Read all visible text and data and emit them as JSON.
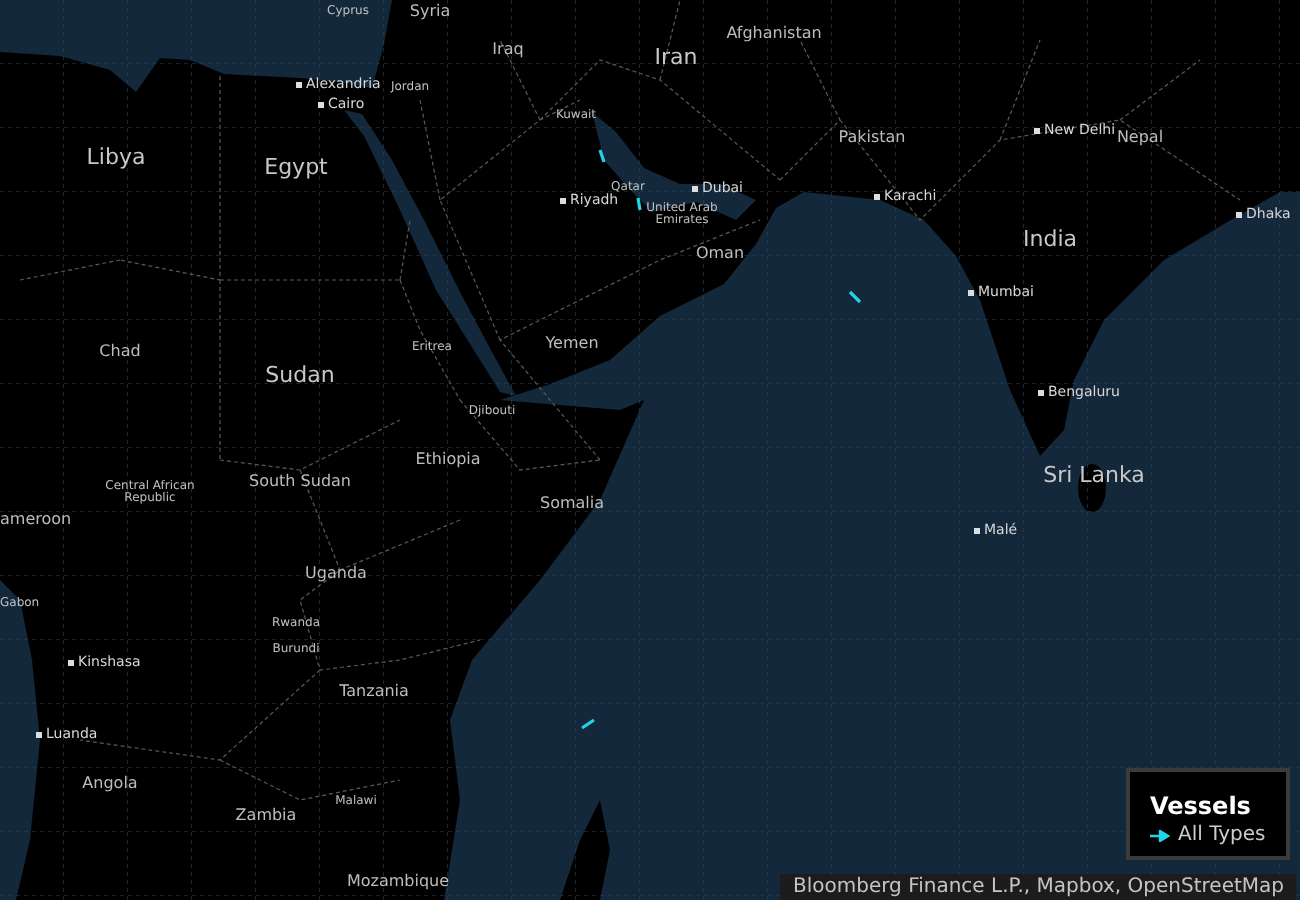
{
  "map": {
    "labels": [
      {
        "text": "Cyprus",
        "kind": "small"
      },
      {
        "text": "Syria",
        "kind": "country"
      },
      {
        "text": "Iraq",
        "kind": "country"
      },
      {
        "text": "Iran",
        "kind": "major"
      },
      {
        "text": "Afghanistan",
        "kind": "country"
      },
      {
        "text": "Alexandria",
        "kind": "city"
      },
      {
        "text": "Cairo",
        "kind": "city"
      },
      {
        "text": "Jordan",
        "kind": "small"
      },
      {
        "text": "Kuwait",
        "kind": "small"
      },
      {
        "text": "Libya",
        "kind": "major"
      },
      {
        "text": "Egypt",
        "kind": "major"
      },
      {
        "text": "Pakistan",
        "kind": "country"
      },
      {
        "text": "New Delhi",
        "kind": "city"
      },
      {
        "text": "Nepal",
        "kind": "country"
      },
      {
        "text": "Qatar",
        "kind": "small"
      },
      {
        "text": "Dubai",
        "kind": "city"
      },
      {
        "text": "Riyadh",
        "kind": "city"
      },
      {
        "text": "Karachi",
        "kind": "city"
      },
      {
        "text": "United Arab Emirates",
        "kind": "small"
      },
      {
        "text": "Dhaka",
        "kind": "city"
      },
      {
        "text": "Oman",
        "kind": "country"
      },
      {
        "text": "India",
        "kind": "major"
      },
      {
        "text": "Mumbai",
        "kind": "city"
      },
      {
        "text": "Yemen",
        "kind": "country"
      },
      {
        "text": "Chad",
        "kind": "country"
      },
      {
        "text": "Eritrea",
        "kind": "small"
      },
      {
        "text": "Sudan",
        "kind": "major"
      },
      {
        "text": "Bengaluru",
        "kind": "city"
      },
      {
        "text": "Djibouti",
        "kind": "small"
      },
      {
        "text": "Ethiopia",
        "kind": "country"
      },
      {
        "text": "Sri Lanka",
        "kind": "major"
      },
      {
        "text": "South Sudan",
        "kind": "country"
      },
      {
        "text": "Central African Republic",
        "kind": "small"
      },
      {
        "text": "Somalia",
        "kind": "country"
      },
      {
        "text": "ameroon",
        "kind": "country"
      },
      {
        "text": "Malé",
        "kind": "city"
      },
      {
        "text": "Uganda",
        "kind": "country"
      },
      {
        "text": "Gabon",
        "kind": "small"
      },
      {
        "text": "Rwanda",
        "kind": "small"
      },
      {
        "text": "Burundi",
        "kind": "small"
      },
      {
        "text": "Kinshasa",
        "kind": "city"
      },
      {
        "text": "Tanzania",
        "kind": "country"
      },
      {
        "text": "Luanda",
        "kind": "city"
      },
      {
        "text": "Angola",
        "kind": "country"
      },
      {
        "text": "Zambia",
        "kind": "country"
      },
      {
        "text": "Malawi",
        "kind": "small"
      },
      {
        "text": "Mozambique",
        "kind": "country"
      }
    ]
  },
  "legend": {
    "title": "Vessels",
    "items": [
      {
        "label": "All Types"
      }
    ]
  },
  "attribution": "Bloomberg Finance L.P., Mapbox, OpenStreetMap"
}
